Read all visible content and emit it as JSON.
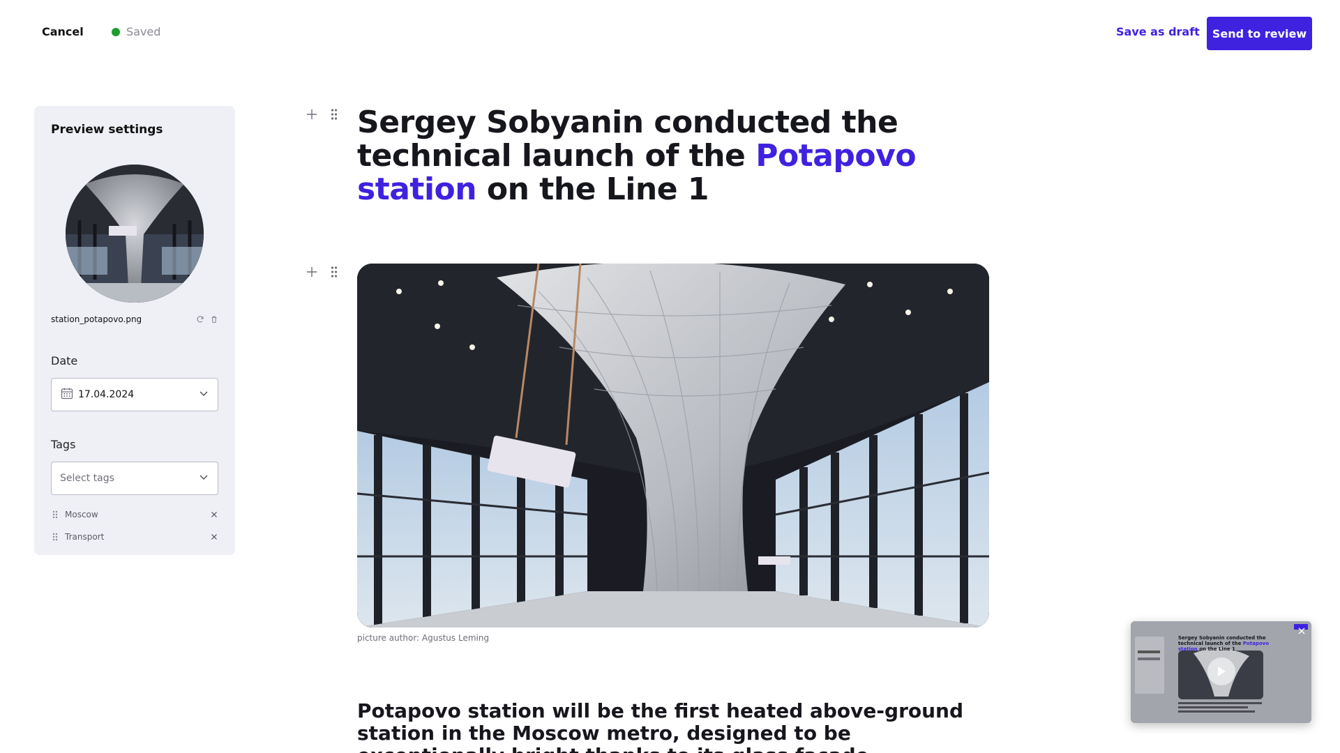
{
  "topbar": {
    "cancel_label": "Cancel",
    "status_label": "Saved",
    "status_color": "#1c9e2e",
    "draft_label": "Save as draft",
    "review_label": "Send to review",
    "accent_color": "#3f22e0"
  },
  "preview_settings": {
    "title": "Preview settings",
    "file_name": "station_potapovo.png",
    "date": {
      "label": "Date",
      "value": "17.04.2024",
      "icon": "calendar-icon"
    },
    "tags": {
      "label": "Tags",
      "placeholder": "Select tags",
      "items": [
        {
          "label": "Moscow"
        },
        {
          "label": "Transport"
        }
      ]
    }
  },
  "article": {
    "headline_part1": "Sergey Sobyanin conducted the technical launch of the ",
    "headline_accent": "Potapovo station",
    "headline_part2": " on the Line 1",
    "image_caption": "picture author: Agustus Leming",
    "lede": "Potapovo station will be the first heated above-ground station in the Moscow metro, designed to be exceptionally bright thanks to its glass facade"
  },
  "mini_preview": {
    "title_part1": "Sergey Sobyanin conducted the technical launch of the ",
    "title_accent": "Potapovo station",
    "title_part2": " on the Line 1"
  }
}
